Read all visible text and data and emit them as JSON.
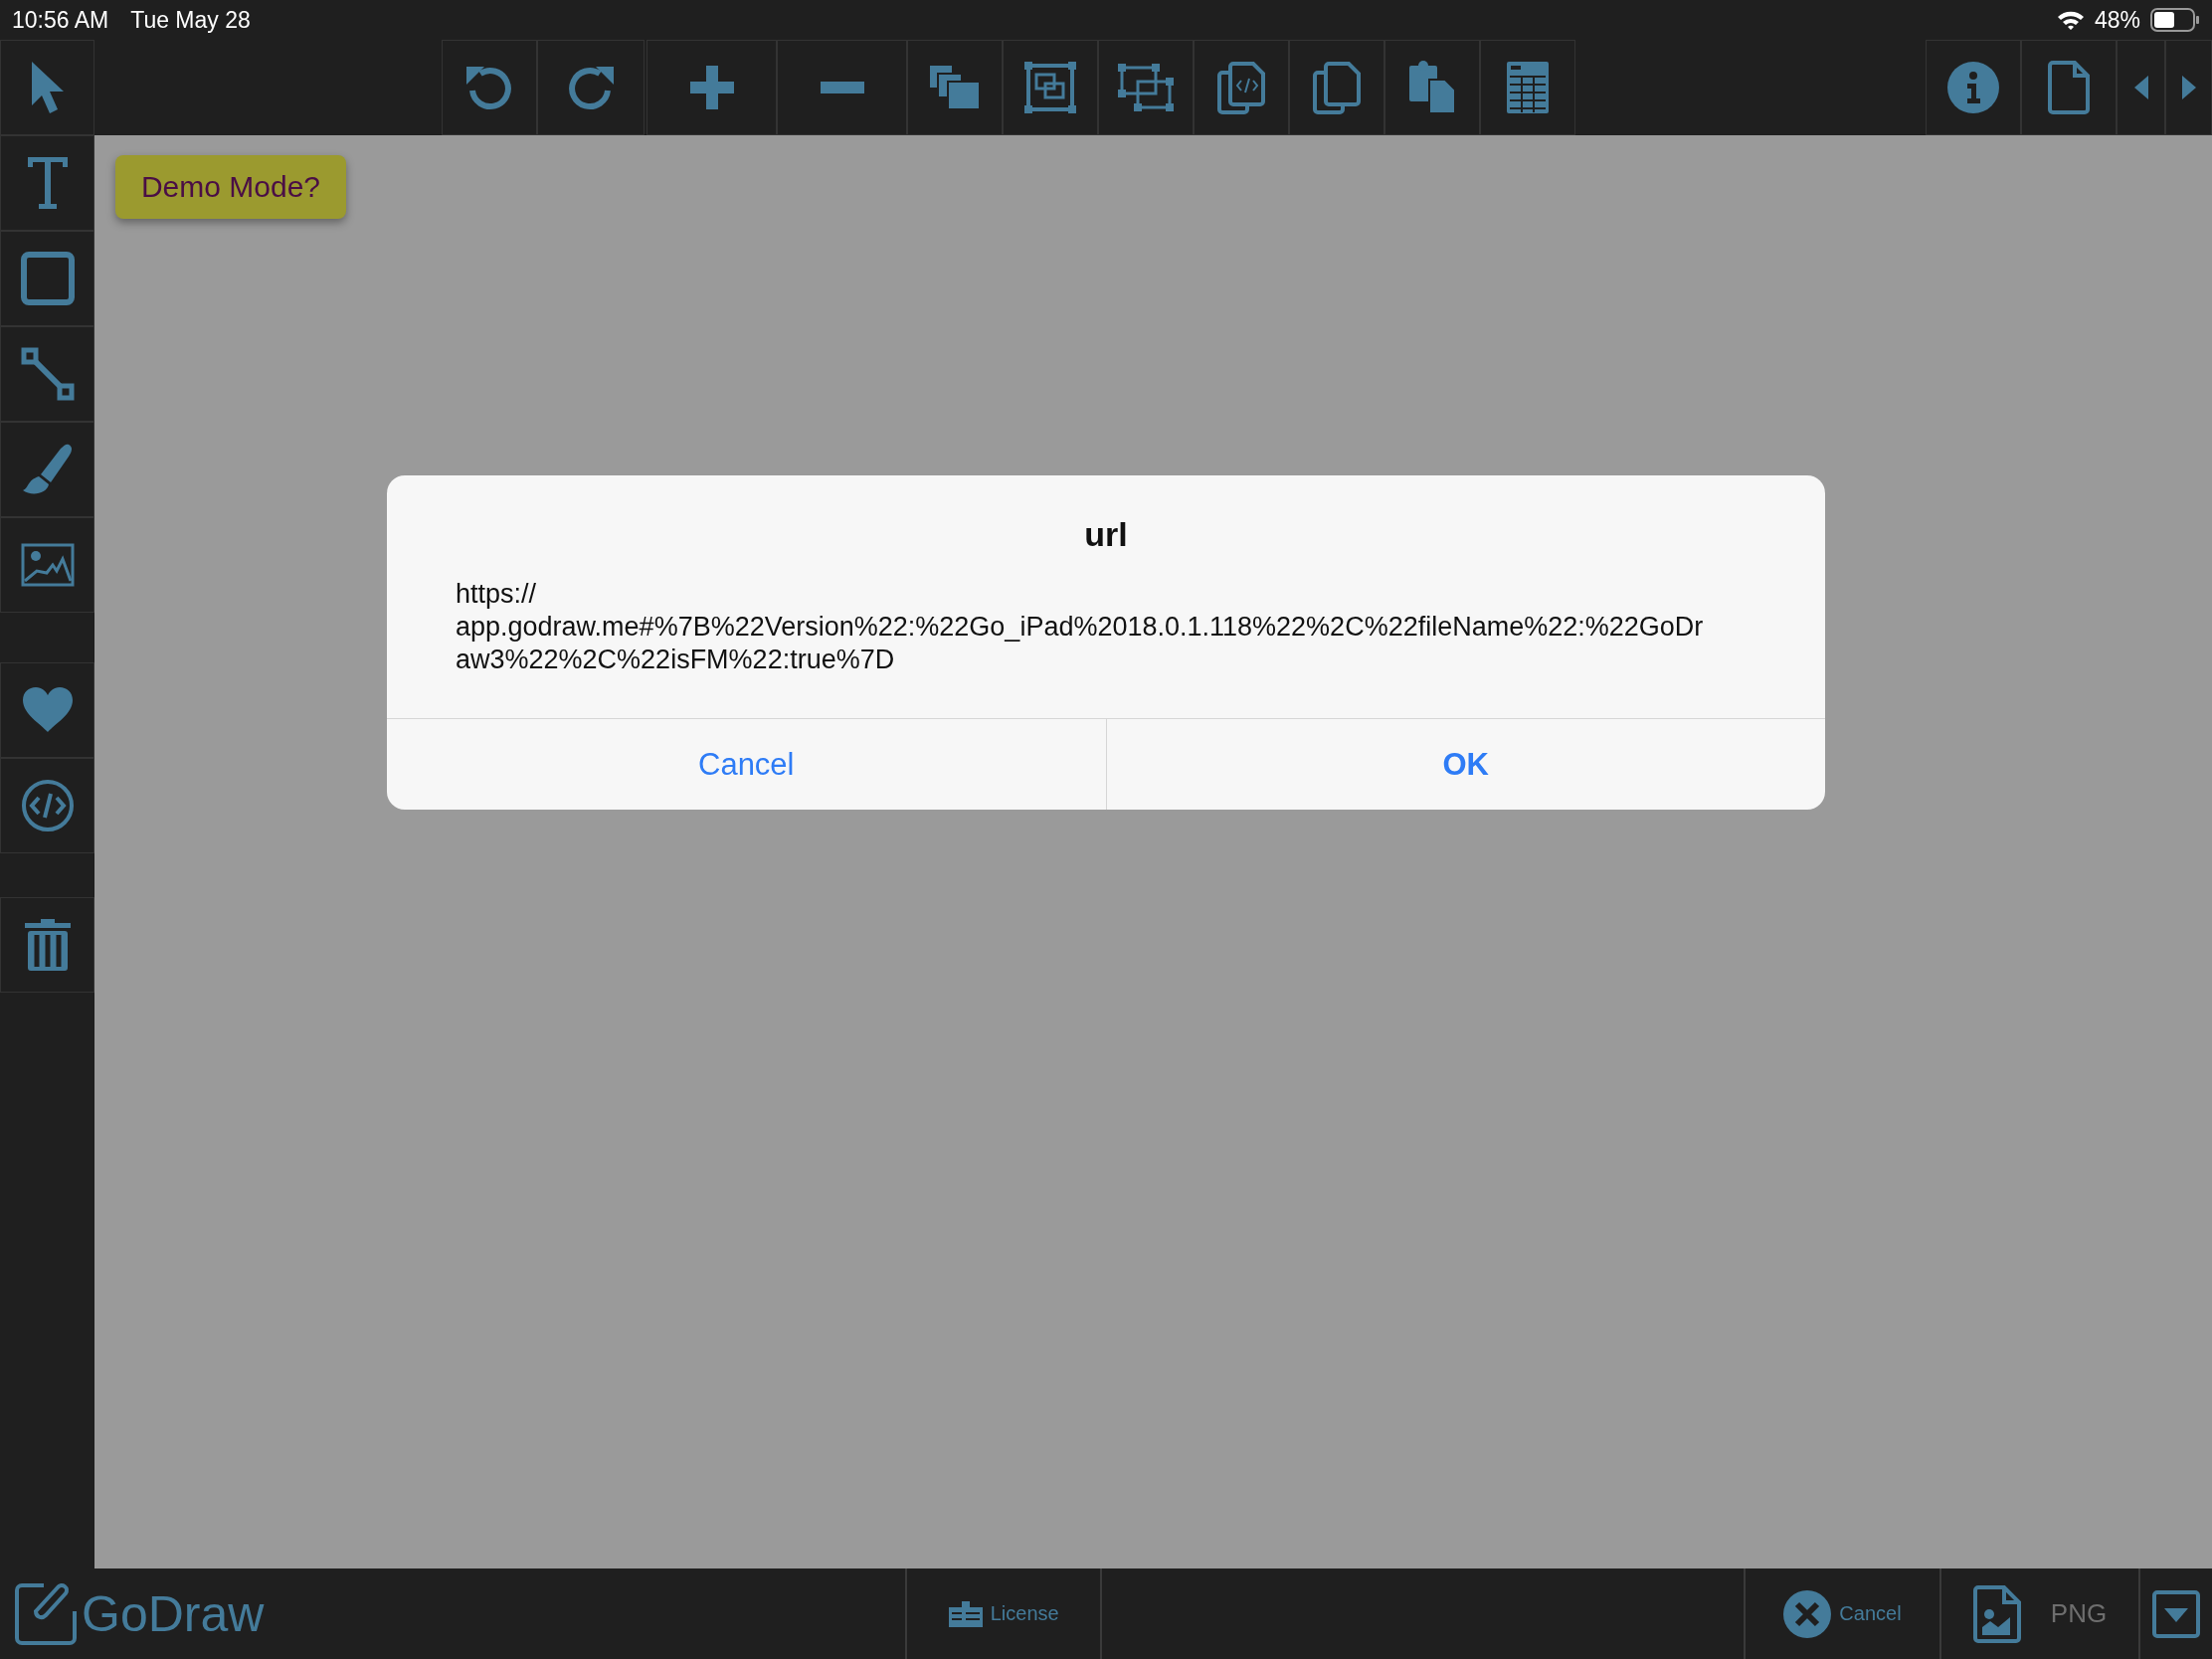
{
  "status_bar": {
    "time": "10:56 AM",
    "date": "Tue May 28",
    "battery": "48%"
  },
  "demo_button": "Demo Mode?",
  "dialog": {
    "title": "url",
    "message": "https://\napp.godraw.me#%7B%22Version%22:%22Go_iPad%2018.0.1.118%22%2C%22fileName%22:%22GoDr\naw3%22%2C%22isFM%22:true%7D",
    "buttons": [
      {
        "label": "Cancel",
        "kind": "cancel"
      },
      {
        "label": "OK",
        "kind": "default"
      }
    ]
  },
  "logo": "GoDraw",
  "bottom_bar": [
    {
      "label": "License",
      "kind": "license"
    },
    {
      "label": "Cancel",
      "kind": "cancel"
    },
    {
      "label": "PNG",
      "kind": "png"
    }
  ]
}
